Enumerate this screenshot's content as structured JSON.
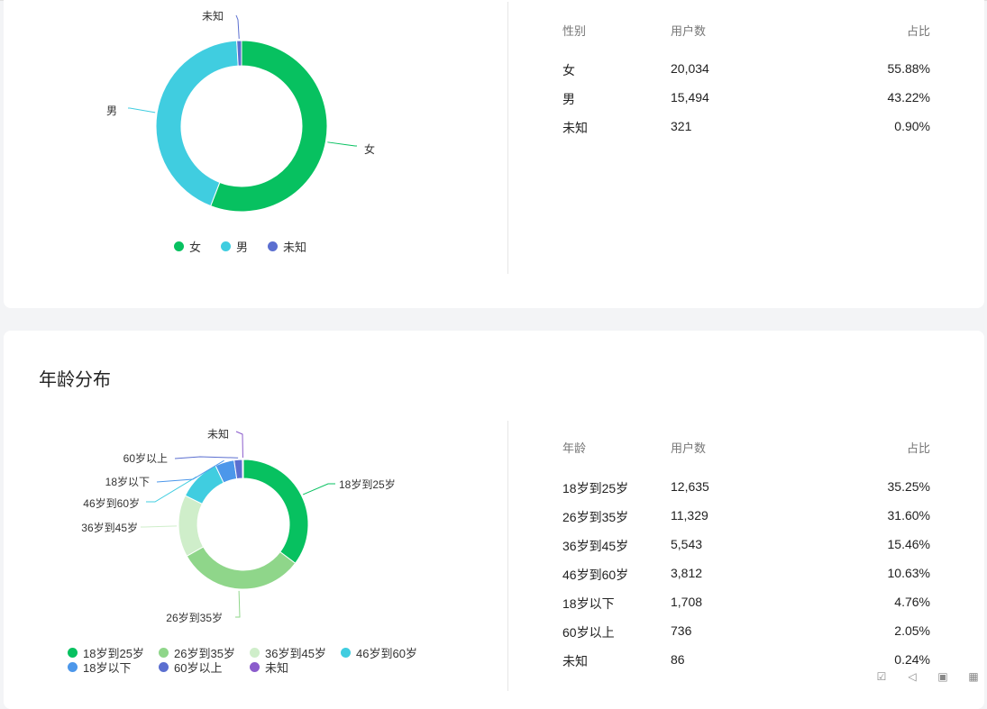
{
  "gender": {
    "table_headers": [
      "性别",
      "用户数",
      "占比"
    ],
    "rows": [
      {
        "label": "女",
        "count": "20,034",
        "pct": "55.88%"
      },
      {
        "label": "男",
        "count": "15,494",
        "pct": "43.22%"
      },
      {
        "label": "未知",
        "count": "321",
        "pct": "0.90%"
      }
    ],
    "legend": [
      "女",
      "男",
      "未知"
    ]
  },
  "age": {
    "title": "年龄分布",
    "table_headers": [
      "年龄",
      "用户数",
      "占比"
    ],
    "rows": [
      {
        "label": "18岁到25岁",
        "count": "12,635",
        "pct": "35.25%"
      },
      {
        "label": "26岁到35岁",
        "count": "11,329",
        "pct": "31.60%"
      },
      {
        "label": "36岁到45岁",
        "count": "5,543",
        "pct": "15.46%"
      },
      {
        "label": "46岁到60岁",
        "count": "3,812",
        "pct": "10.63%"
      },
      {
        "label": "18岁以下",
        "count": "1,708",
        "pct": "4.76%"
      },
      {
        "label": "60岁以上",
        "count": "736",
        "pct": "2.05%"
      },
      {
        "label": "未知",
        "count": "86",
        "pct": "0.24%"
      }
    ],
    "legend": [
      "18岁到25岁",
      "26岁到35岁",
      "36岁到45岁",
      "46岁到60岁",
      "18岁以下",
      "60岁以上",
      "未知"
    ]
  },
  "chart_data": [
    {
      "type": "pie",
      "categories": [
        "女",
        "男",
        "未知"
      ],
      "values": [
        55.88,
        43.22,
        0.9
      ],
      "colors": [
        "#07c160",
        "#40cde0",
        "#5b6fd0"
      ],
      "legend_position": "bottom"
    },
    {
      "type": "pie",
      "title": "年龄分布",
      "categories": [
        "18岁到25岁",
        "26岁到35岁",
        "36岁到45岁",
        "46岁到60岁",
        "18岁以下",
        "60岁以上",
        "未知"
      ],
      "values": [
        35.25,
        31.6,
        15.46,
        10.63,
        4.76,
        2.05,
        0.24
      ],
      "colors": [
        "#07c160",
        "#8fd68a",
        "#cfeeca",
        "#40cde0",
        "#4c97ea",
        "#5b6fd0",
        "#8b5ccc"
      ],
      "legend_position": "bottom"
    }
  ],
  "statusbar_icons": [
    "check-icon",
    "speaker-icon",
    "clipboard-icon",
    "grid-icon"
  ]
}
